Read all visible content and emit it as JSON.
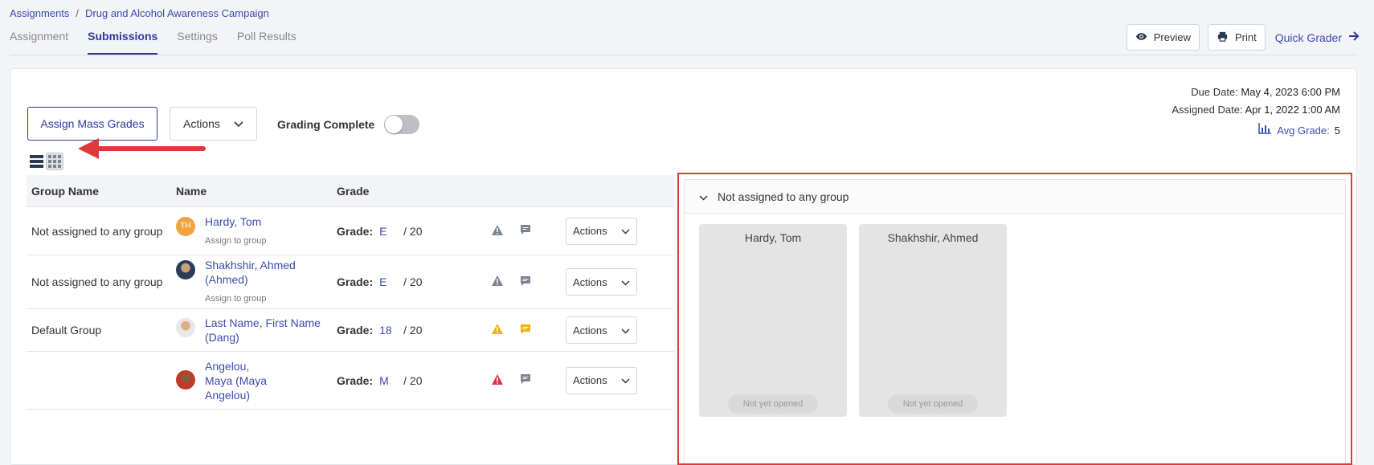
{
  "breadcrumb": {
    "root": "Assignments",
    "sep": "/",
    "current": "Drug and Alcohol Awareness Campaign"
  },
  "tabs": [
    {
      "label": "Assignment",
      "active": false
    },
    {
      "label": "Submissions",
      "active": true
    },
    {
      "label": "Settings",
      "active": false
    },
    {
      "label": "Poll Results",
      "active": false
    }
  ],
  "top_actions": {
    "preview": "Preview",
    "print": "Print",
    "quick_grader": "Quick Grader"
  },
  "meta": {
    "due_label": "Due Date:",
    "due_value": "May 4, 2023 6:00 PM",
    "assigned_label": "Assigned Date:",
    "assigned_value": "Apr 1, 2022 1:00 AM",
    "avg_label": "Avg Grade:",
    "avg_value": "5"
  },
  "toolbar": {
    "mass_grades": "Assign Mass Grades",
    "actions": "Actions",
    "grading_complete": "Grading Complete",
    "grading_complete_on": false
  },
  "table": {
    "headers": {
      "group": "Group Name",
      "name": "Name",
      "grade": "Grade"
    },
    "grade_label": "Grade:",
    "actions_label": "Actions",
    "rows": [
      {
        "group": "Not assigned to any group",
        "initials": "TH",
        "name": "Hardy, Tom",
        "assign": "Assign to group",
        "grade": "E",
        "out_of": "/ 20"
      },
      {
        "group": "Not assigned to any group",
        "name": "Shakhshir, Ahmed (Ahmed)",
        "assign": "Assign to group",
        "grade": "E",
        "out_of": "/ 20"
      },
      {
        "group": "Default Group",
        "name": "Last Name, First Name (Dang)",
        "assign": "",
        "grade": "18",
        "out_of": "/ 20"
      },
      {
        "group": "",
        "name": "Angelou, Maya (Maya Angelou)",
        "assign": "",
        "grade": "M",
        "out_of": "/ 20"
      }
    ]
  },
  "panel": {
    "header": "Not assigned to any group",
    "tiles": [
      {
        "name": "Hardy, Tom",
        "status": "Not yet opened"
      },
      {
        "name": "Shakhshir, Ahmed",
        "status": "Not yet opened"
      }
    ]
  },
  "colors": {
    "accent": "#2d3a9c",
    "link": "#3b4bb0",
    "highlight": "#e0393a",
    "warn_yellow": "#f0b400",
    "warn_red": "#d9363e"
  }
}
